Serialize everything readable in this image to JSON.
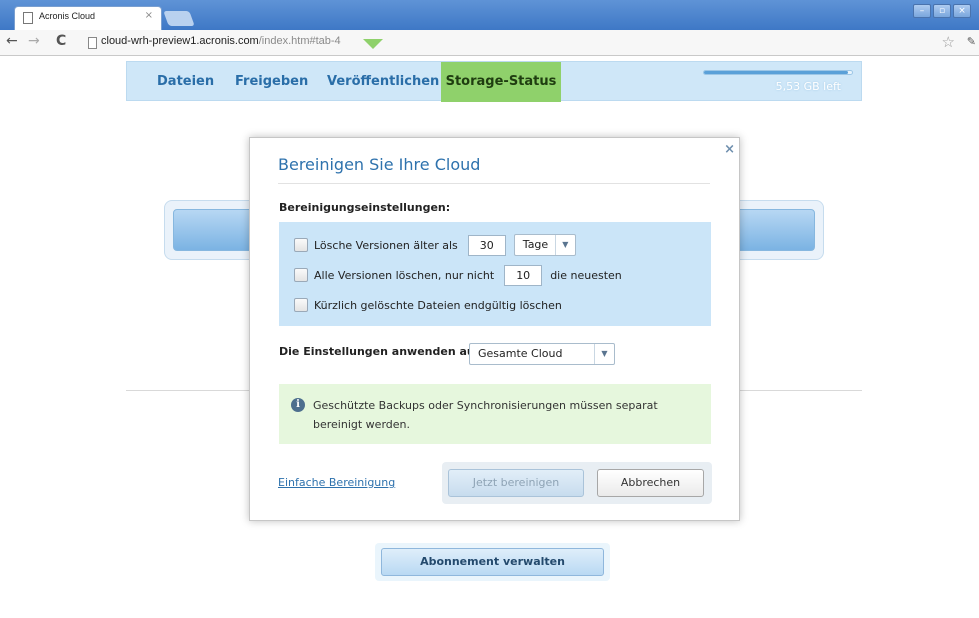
{
  "browser": {
    "tab_title": "Acronis Cloud",
    "tab_close": "×",
    "url_host": "cloud-wrh-preview1.acronis.com",
    "url_path": "/index.htm#tab-4",
    "window_buttons": [
      "–",
      "▫",
      "×"
    ]
  },
  "nav": {
    "items": [
      "Dateien",
      "Freigeben",
      "Veröffentlichen",
      "Storage-Status"
    ],
    "active_index": 3,
    "storage_left": "5,53 GB left",
    "storage_used_fraction": 0.97
  },
  "modal": {
    "title": "Bereinigen Sie Ihre Cloud",
    "close": "×",
    "settings_label": "Bereinigungseinstellungen:",
    "opt1_label": "Lösche Versionen älter als",
    "opt1_value": "30",
    "opt1_unit": "Tage",
    "opt2_label": "Alle Versionen löschen, nur nicht",
    "opt2_value": "10",
    "opt2_suffix": "die neuesten",
    "opt3_label": "Kürzlich gelöschte Dateien endgültig löschen",
    "apply_label": "Die Einstellungen anwenden auf:",
    "apply_value": "Gesamte Cloud",
    "info_text": "Geschützte Backups oder Synchronisierungen müssen separat bereinigt werden.",
    "simple_link": "Einfache Bereinigung",
    "btn_now": "Jetzt bereinigen",
    "btn_cancel": "Abbrechen"
  },
  "page": {
    "manage_button": "Abonnement verwalten"
  },
  "colors": {
    "accent": "#2e72ad",
    "nav_active": "#8fd16b",
    "options_bg": "#cbe5f8",
    "info_bg": "#e6f7dd"
  }
}
